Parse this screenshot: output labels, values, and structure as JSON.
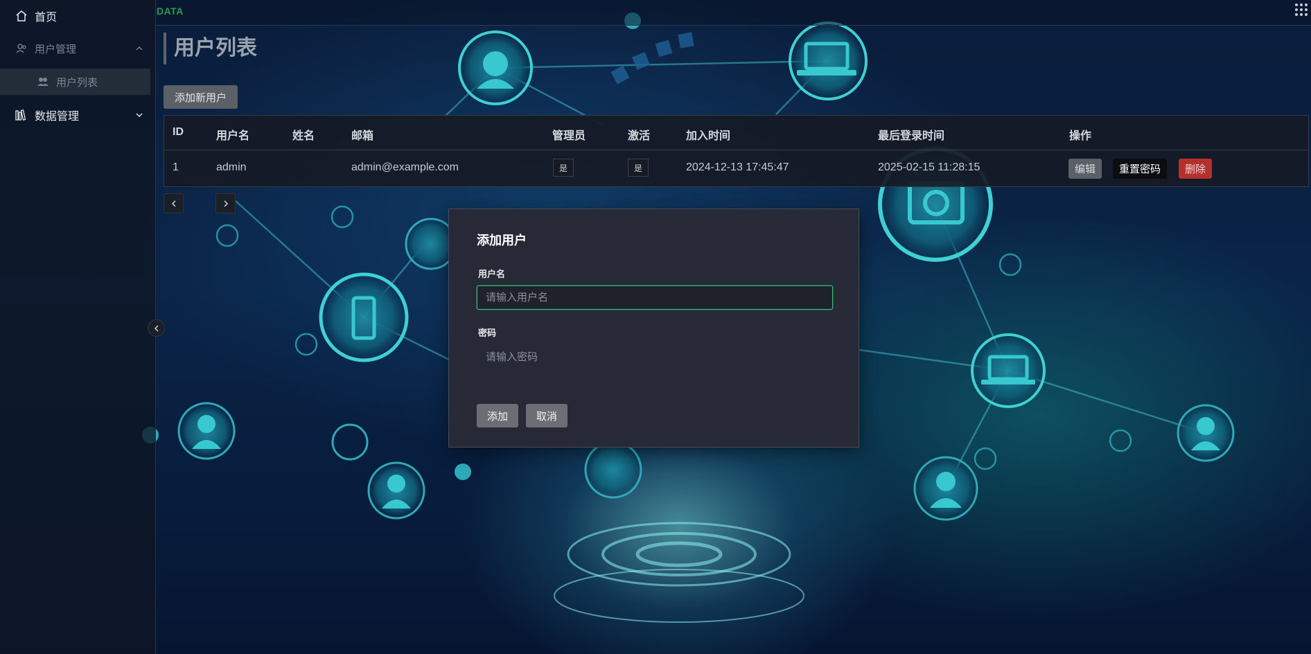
{
  "brand": "DATA",
  "sidebar": {
    "items": [
      {
        "label": "首页",
        "icon": "home-icon"
      },
      {
        "label": "用户管理",
        "icon": "users-icon",
        "expanded": true
      },
      {
        "label": "用户列表",
        "icon": "user-group-icon",
        "active": true
      },
      {
        "label": "数据管理",
        "icon": "books-icon",
        "expanded": false
      }
    ]
  },
  "main": {
    "page_title": "用户列表",
    "add_user_label": "添加新用户",
    "table": {
      "columns": [
        "ID",
        "用户名",
        "姓名",
        "邮箱",
        "管理员",
        "激活",
        "加入时间",
        "最后登录时间",
        "操作"
      ],
      "rows": [
        {
          "id": "1",
          "username": "admin",
          "name": "",
          "email": "admin@example.com",
          "is_admin": "是",
          "is_active": "是",
          "joined": "2024-12-13 17:45:47",
          "last_login": "2025-02-15 11:28:15",
          "actions": [
            "编辑",
            "重置密码",
            "删除"
          ]
        }
      ]
    }
  },
  "modal": {
    "title": "添加用户",
    "username_label": "用户名",
    "username_placeholder": "请输入用户名",
    "password_label": "密码",
    "password_placeholder": "请输入密码",
    "submit_label": "添加",
    "cancel_label": "取消"
  },
  "colors": {
    "accent_green": "#34c27a",
    "danger": "#b3302e",
    "sidebar_bg": "#0e1624"
  }
}
